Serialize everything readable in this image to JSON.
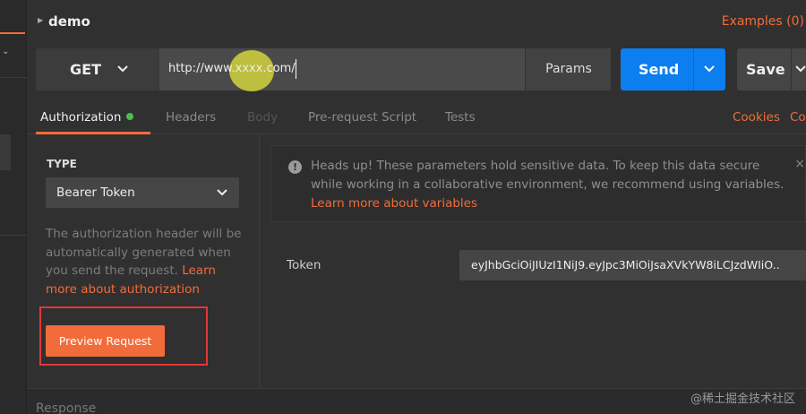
{
  "request": {
    "title": "demo",
    "examples_label": "Examples (0)",
    "method": "GET",
    "url": "http://www.xxxx.com/",
    "params_label": "Params",
    "send_label": "Send",
    "save_label": "Save"
  },
  "tabs": {
    "authorization": "Authorization",
    "headers": "Headers",
    "body": "Body",
    "prerequest": "Pre-request Script",
    "tests": "Tests",
    "cookies": "Cookies",
    "code": "Co"
  },
  "auth": {
    "type_label": "TYPE",
    "type_value": "Bearer Token",
    "help_text": "The authorization header will be automatically generated when you send the request. ",
    "help_link": "Learn more about authorization",
    "preview_label": "Preview Request"
  },
  "notice": {
    "text": "Heads up! These parameters hold sensitive data. To keep this data secure while working in a collaborative environment, we recommend using variables. ",
    "link": "Learn more about variables",
    "close": "×"
  },
  "token": {
    "label": "Token",
    "value": "eyJhbGciOiJIUzI1NiJ9.eyJpc3MiOiJsaXVkYW8iLCJzdWIiO.."
  },
  "response": {
    "label": "Response"
  },
  "watermark": "@稀土掘金技术社区",
  "colors": {
    "accent": "#f26b3a",
    "send": "#0b7ef0",
    "status_dot": "#49c04a",
    "highlight": "#e03838"
  }
}
